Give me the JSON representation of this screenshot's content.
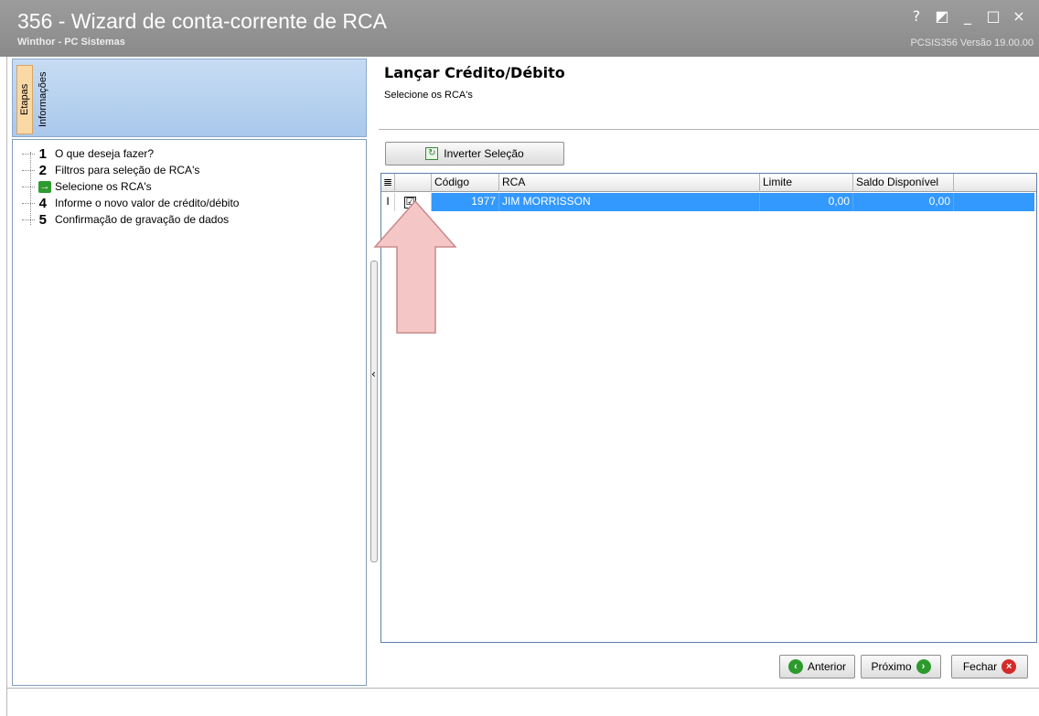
{
  "window": {
    "title": "356 - Wizard de conta-corrente de RCA",
    "subtitle": "Winthor - PC Sistemas",
    "version": "PCSIS356  Versão 19.00.00",
    "controls": [
      "?",
      "◩",
      "_",
      "□",
      "×"
    ]
  },
  "left_panel": {
    "tabs": [
      "Etapas",
      "Informações"
    ],
    "steps": [
      {
        "num": "1",
        "label": "O que deseja fazer?"
      },
      {
        "num": "2",
        "label": "Filtros para seleção de RCA's"
      },
      {
        "num": "→",
        "label": "Selecione os RCA's"
      },
      {
        "num": "4",
        "label": "Informe o novo valor de crédito/débito"
      },
      {
        "num": "5",
        "label": "Confirmação de gravação de dados"
      }
    ]
  },
  "header": {
    "title": "Lançar Crédito/Débito",
    "subtitle": "Selecione os RCA's"
  },
  "toolbar": {
    "invert_label": "Inverter Seleção"
  },
  "grid": {
    "columns": [
      "Código",
      "RCA",
      "Limite",
      "Saldo Disponível"
    ],
    "rows": [
      {
        "indicator": "I",
        "checked": "☑",
        "codigo": "1977",
        "rca": "JIM MORRISSON",
        "limite": "0,00",
        "saldo": "0,00"
      }
    ]
  },
  "buttons": {
    "anterior": "Anterior",
    "proximo": "Próximo",
    "fechar": "Fechar"
  },
  "colors": {
    "titlebar": "#8f8f8f",
    "selection": "#3399ff",
    "arrow_annotation": "#f3c2c2"
  }
}
